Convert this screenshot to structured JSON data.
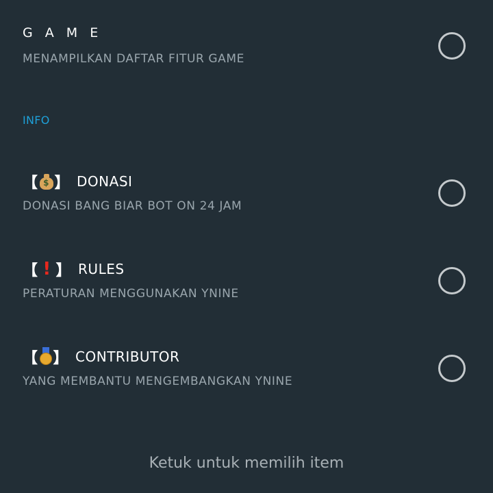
{
  "items": [
    {
      "title": "G A M E",
      "description": "MENAMPILKAN DAFTAR FITUR GAME"
    },
    {
      "icon": "money-bag-icon",
      "title": "DONASI",
      "description": "DONASI BANG BIAR BOT ON 24 JAM"
    },
    {
      "icon": "exclamation-icon",
      "title": "RULES",
      "description": "PERATURAN MENGGUNAKAN YNINE"
    },
    {
      "icon": "medal-icon",
      "title": "CONTRIBUTOR",
      "description": "YANG MEMBANTU MENGEMBANGKAN YNINE"
    }
  ],
  "section": {
    "info_header": "INFO"
  },
  "bracket_open": "【",
  "bracket_close": "】",
  "money_sign": "$",
  "exclamation": "!",
  "footer": {
    "hint": "Ketuk untuk memilih item"
  },
  "colors": {
    "background": "#222e36",
    "section_header": "#1ea0d8",
    "title": "#ffffff",
    "description": "#9aa6ad",
    "radio_border": "#c4c9cc"
  }
}
